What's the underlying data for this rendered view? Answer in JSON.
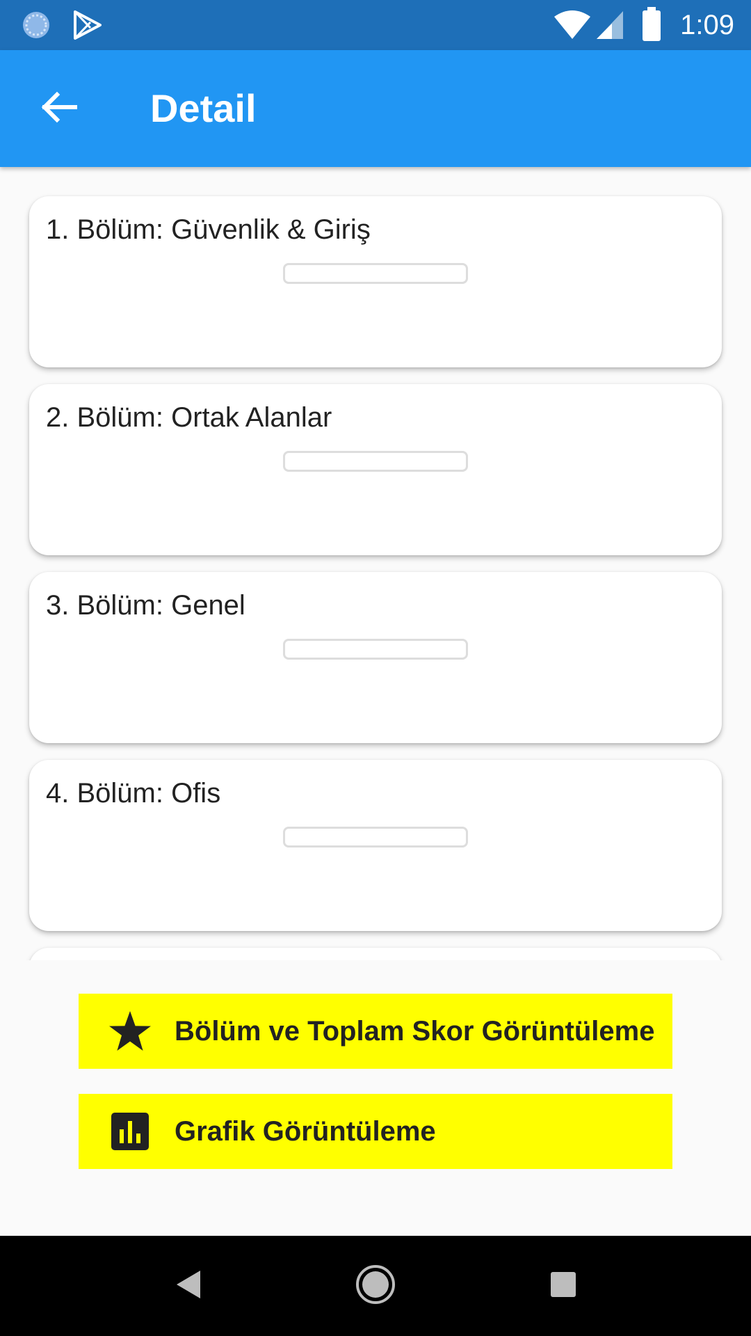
{
  "status_bar": {
    "time": "1:09",
    "icons": [
      "sync-icon",
      "play-store-icon",
      "wifi-icon",
      "cell-signal-icon",
      "battery-icon"
    ]
  },
  "app_bar": {
    "title": "Detail",
    "back_icon": "arrow-back-icon"
  },
  "sections": [
    {
      "title": "1. Bölüm: Güvenlik & Giriş",
      "progress": 0
    },
    {
      "title": "2. Bölüm: Ortak Alanlar",
      "progress": 0
    },
    {
      "title": "3. Bölüm: Genel",
      "progress": 0
    },
    {
      "title": "4. Bölüm: Ofis",
      "progress": 0
    },
    {
      "title": "",
      "progress": 0
    }
  ],
  "buttons": {
    "score": {
      "label": "Bölüm ve Toplam Skor Görüntüleme",
      "icon": "star-icon"
    },
    "chart": {
      "label": "Grafik Görüntüleme",
      "icon": "bar-chart-icon"
    }
  },
  "colors": {
    "status_bar": "#1e6fb8",
    "app_bar": "#2196f3",
    "button_bg": "#ffff00",
    "background": "#fafafa"
  },
  "nav_bar": {
    "icons": [
      "back-triangle-icon",
      "home-circle-icon",
      "recents-square-icon"
    ]
  }
}
